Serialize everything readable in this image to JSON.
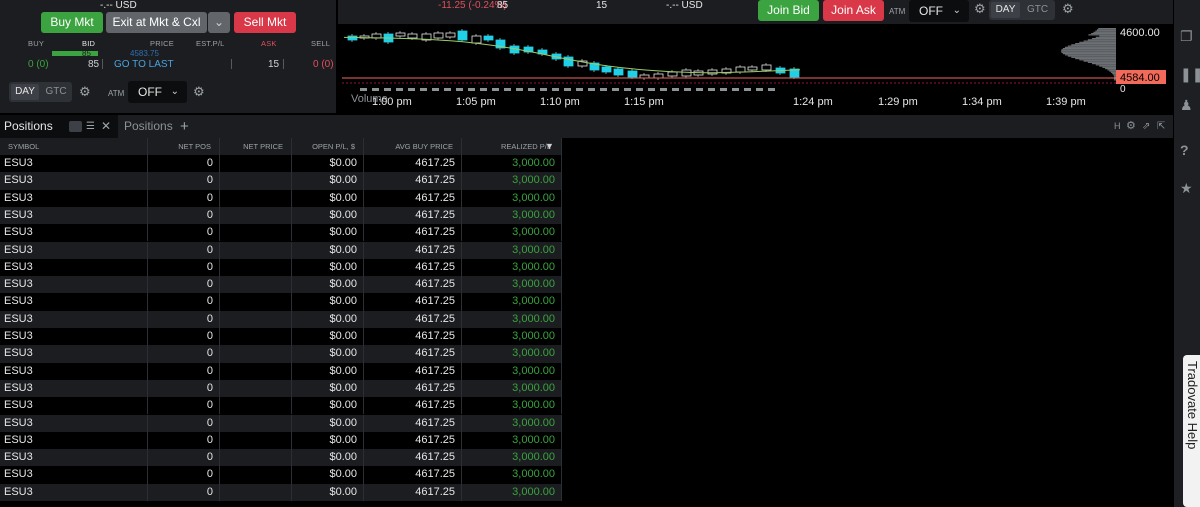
{
  "order_panel": {
    "usd_label": "-.-- USD",
    "buy_mkt": "Buy Mkt",
    "exit_mkt_cxl": "Exit at Mkt & Cxl",
    "sell_mkt": "Sell Mkt",
    "headers": {
      "buy": "BUY",
      "bid": "BID",
      "price": "PRICE",
      "est_pl": "EST.P/L",
      "ask": "ASK",
      "sell": "SELL"
    },
    "bid_size": "85",
    "price_value": "4583.75",
    "buy_pos": "0 (0)",
    "go_to_last": "GO TO LAST",
    "ask_size": "15",
    "sell_pos": "0 (0)",
    "day": "DAY",
    "gtc": "GTC",
    "atm_label": "ATM",
    "atm_value": "OFF"
  },
  "chart_toolbar": {
    "change": "-11.25 (-0.24%)",
    "bid_size": "85",
    "ask_size": "15",
    "usd_label": "-.-- USD",
    "join_bid": "Join Bid",
    "join_ask": "Join Ask",
    "atm_label": "ATM",
    "atm_value": "OFF",
    "day": "DAY",
    "gtc": "GTC"
  },
  "chart_data": {
    "type": "candlestick",
    "x_ticks": [
      "1:00 pm",
      "1:05 pm",
      "1:10 pm",
      "1:15 pm",
      "1:24 pm",
      "1:29 pm",
      "1:34 pm",
      "1:39 pm"
    ],
    "price_labels": [
      "4600.00",
      "4584.00"
    ],
    "volume_label": "Volume",
    "volume_value": "0",
    "colors": {
      "up": "#e6e6e6",
      "down": "#1fd0e8",
      "ma": "#9ccc65",
      "ma2": "#f06292",
      "last_price": "#f26a5a"
    }
  },
  "positions": {
    "panel_title": "Positions",
    "tab_label": "Positions",
    "columns": [
      "SYMBOL",
      "NET POS",
      "NET PRICE",
      "OPEN P/L, $",
      "AVG BUY PRICE",
      "REALIZED P/L"
    ],
    "rows": [
      [
        "ESU3",
        "0",
        "",
        "$0.00",
        "4617.25",
        "3,000.00"
      ],
      [
        "ESU3",
        "0",
        "",
        "$0.00",
        "4617.25",
        "3,000.00"
      ],
      [
        "ESU3",
        "0",
        "",
        "$0.00",
        "4617.25",
        "3,000.00"
      ],
      [
        "ESU3",
        "0",
        "",
        "$0.00",
        "4617.25",
        "3,000.00"
      ],
      [
        "ESU3",
        "0",
        "",
        "$0.00",
        "4617.25",
        "3,000.00"
      ],
      [
        "ESU3",
        "0",
        "",
        "$0.00",
        "4617.25",
        "3,000.00"
      ],
      [
        "ESU3",
        "0",
        "",
        "$0.00",
        "4617.25",
        "3,000.00"
      ],
      [
        "ESU3",
        "0",
        "",
        "$0.00",
        "4617.25",
        "3,000.00"
      ],
      [
        "ESU3",
        "0",
        "",
        "$0.00",
        "4617.25",
        "3,000.00"
      ],
      [
        "ESU3",
        "0",
        "",
        "$0.00",
        "4617.25",
        "3,000.00"
      ],
      [
        "ESU3",
        "0",
        "",
        "$0.00",
        "4617.25",
        "3,000.00"
      ],
      [
        "ESU3",
        "0",
        "",
        "$0.00",
        "4617.25",
        "3,000.00"
      ],
      [
        "ESU3",
        "0",
        "",
        "$0.00",
        "4617.25",
        "3,000.00"
      ],
      [
        "ESU3",
        "0",
        "",
        "$0.00",
        "4617.25",
        "3,000.00"
      ],
      [
        "ESU3",
        "0",
        "",
        "$0.00",
        "4617.25",
        "3,000.00"
      ],
      [
        "ESU3",
        "0",
        "",
        "$0.00",
        "4617.25",
        "3,000.00"
      ],
      [
        "ESU3",
        "0",
        "",
        "$0.00",
        "4617.25",
        "3,000.00"
      ],
      [
        "ESU3",
        "0",
        "",
        "$0.00",
        "4617.25",
        "3,000.00"
      ],
      [
        "ESU3",
        "0",
        "",
        "$0.00",
        "4617.25",
        "3,000.00"
      ],
      [
        "ESU3",
        "0",
        "",
        "$0.00",
        "4617.25",
        "3,000.00"
      ]
    ]
  },
  "help_tab": "Tradovate Help"
}
